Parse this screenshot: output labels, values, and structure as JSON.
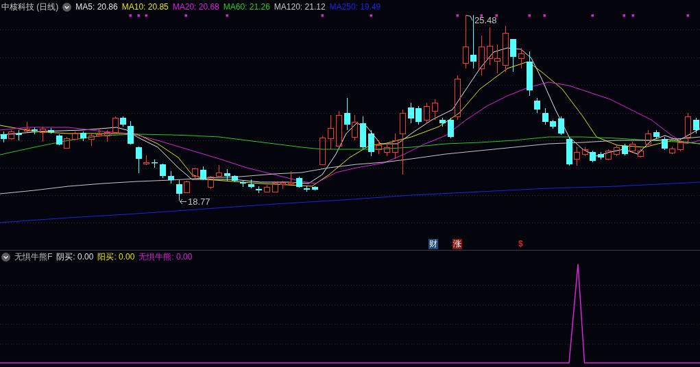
{
  "header": {
    "security": "中核科技 (日线)",
    "indicators": [
      {
        "label": "MA5: 20.86",
        "color": "#e8e8e8"
      },
      {
        "label": "MA10: 20.85",
        "color": "#e6e600"
      },
      {
        "label": "MA20: 20.68",
        "color": "#e020e0"
      },
      {
        "label": "MA60: 21.26",
        "color": "#20d020"
      },
      {
        "label": "MA120: 21.12",
        "color": "#c8c8c8"
      },
      {
        "label": "MA250: 19.49",
        "color": "#2222e6"
      }
    ]
  },
  "price_labels": {
    "high": "25.48",
    "low": "18.77"
  },
  "events": [
    {
      "label": "财",
      "kind": "badge",
      "color": "#1d4a78"
    },
    {
      "label": "涨",
      "kind": "badge",
      "color": "#8a1414"
    },
    {
      "label": "$",
      "kind": "plain",
      "color": "#e02424"
    }
  ],
  "lower_panel": {
    "title": "无惧牛熊F",
    "indicators": [
      {
        "label": "阴买: 0.00",
        "color": "#e0e0e0"
      },
      {
        "label": "阳买: 0.00",
        "color": "#e6e600"
      },
      {
        "label": "无惧牛熊: 0.00",
        "color": "#e020e0"
      }
    ]
  }
}
